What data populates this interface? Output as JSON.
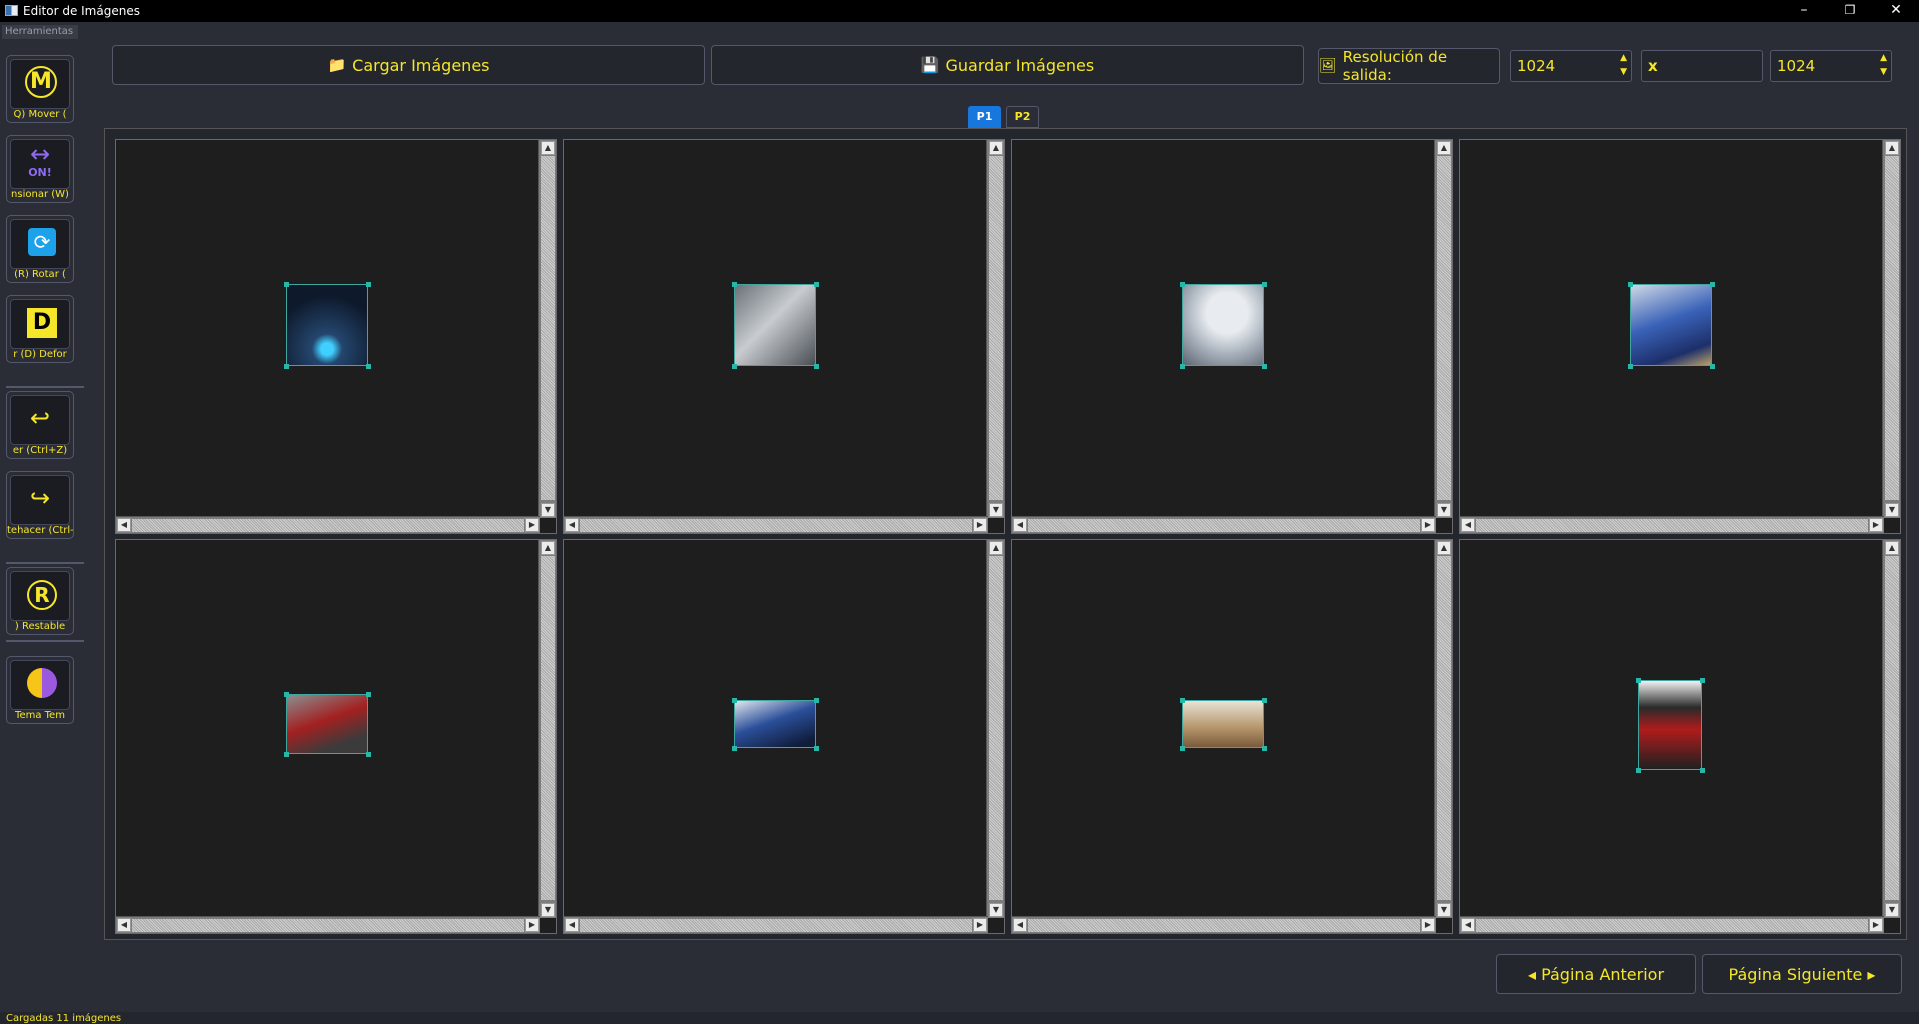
{
  "window": {
    "title": "Editor de Imágenes",
    "controls": {
      "minimize": "–",
      "restore": "❐",
      "close": "✕"
    }
  },
  "sidebar": {
    "header": "Herramientas",
    "tools": [
      {
        "name": "move",
        "icon": "circled-m-icon",
        "glyph": "Ⓜ",
        "label": "Q)   Mover ("
      },
      {
        "name": "resize",
        "icon": "resize-on-icon",
        "glyph": "↔",
        "sub": "ON!",
        "label": "nsionar (W)"
      },
      {
        "name": "rotate",
        "icon": "rotate-icon",
        "glyph": "🔄",
        "label": "(R)   Rotar ("
      },
      {
        "name": "deform",
        "icon": "d-square-icon",
        "glyph": "D",
        "label": "r (D)   Defor"
      },
      {
        "name": "undo",
        "icon": "undo-arrow-icon",
        "glyph": "↩",
        "label": "er (Ctrl+Z)"
      },
      {
        "name": "redo",
        "icon": "redo-arrow-icon",
        "glyph": "↪",
        "label": "tehacer (Ctrl-"
      },
      {
        "name": "reset",
        "icon": "circled-r-icon",
        "glyph": "Ⓡ",
        "label": ")   Restable"
      },
      {
        "name": "theme",
        "icon": "theme-moon-icon",
        "glyph": "◐",
        "label": "Tema   Tem"
      }
    ]
  },
  "toolbar": {
    "load_label": "Cargar Imágenes",
    "load_icon": "📁",
    "save_label": "Guardar Imágenes",
    "save_icon": "💾",
    "resolution_label": "Resolución de salida:",
    "resolution_icon": "🖼",
    "width": "1024",
    "times": "x",
    "height": "1024"
  },
  "tabs": [
    {
      "label": "P1",
      "active": true
    },
    {
      "label": "P2",
      "active": false
    }
  ],
  "grid": {
    "cells": [
      {
        "name": "image-cell-1",
        "image": "cyborg-portrait-1"
      },
      {
        "name": "image-cell-2",
        "image": "robot-number-2"
      },
      {
        "name": "image-cell-3",
        "image": "robot-number-1"
      },
      {
        "name": "image-cell-4",
        "image": "blue-mech-dragon"
      },
      {
        "name": "image-cell-5",
        "image": "red-mech-dragon"
      },
      {
        "name": "image-cell-6",
        "image": "blue-mech-beast"
      },
      {
        "name": "image-cell-7",
        "image": "desert-mech"
      },
      {
        "name": "image-cell-8",
        "image": "poster-figure"
      }
    ]
  },
  "pagination": {
    "prev_label": "◂ Página Anterior",
    "next_label": "Página Siguiente ▸"
  },
  "status": "Cargadas 11 imágenes"
}
